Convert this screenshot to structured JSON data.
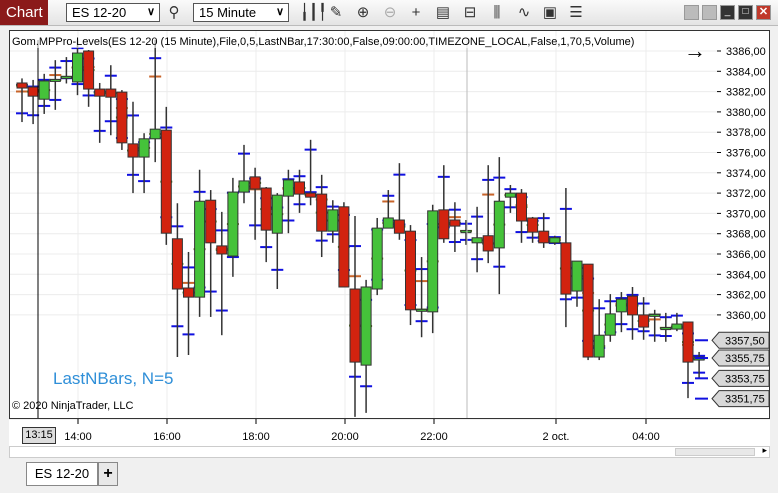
{
  "window": {
    "title": "Chart",
    "instrument": "ES 12-20",
    "interval": "15 Minute"
  },
  "toolbar": {
    "icons": [
      "search-icon",
      "bar-type-icon",
      "draw-icon",
      "zoom-in-icon",
      "zoom-out-icon",
      "crosshair-icon",
      "data-box-icon",
      "properties-icon",
      "indicators-icon",
      "strategies-icon",
      "templates-icon",
      "list-icon"
    ]
  },
  "chart": {
    "indicator_label": "Gom.MPPro-Levels(ES 12-20 (15 Minute),File,0,5,LastNBar,17:30:00,False,09:00:00,TIMEZONE_LOCAL,False,1,70,5,Volume)",
    "overlay_text": "LastNBars, N=5",
    "copyright": "© 2020 NinjaTrader, LLC",
    "cursor_time": "13:15",
    "price_tags": [
      "3357,50",
      "3355,75",
      "3353,75",
      "3351,75"
    ],
    "colors": {
      "up": "#45c23a",
      "down": "#d2230f",
      "level_blue": "#1010e0",
      "level_orange": "#c8642a",
      "level_olive": "#5a7a1a",
      "overlay": "#2f8fd8"
    }
  },
  "bottom": {
    "tab": "ES 12-20",
    "add": "+"
  },
  "chart_data": {
    "type": "candlestick",
    "title": "ES 12-20 (15 Minute)",
    "ylim": [
      3348.5,
      3388
    ],
    "y_ticks": [
      "3386,00",
      "3384,00",
      "3382,00",
      "3380,00",
      "3378,00",
      "3376,00",
      "3374,00",
      "3372,00",
      "3370,00",
      "3368,00",
      "3366,00",
      "3364,00",
      "3362,00",
      "3360,00"
    ],
    "x_ticks": [
      "14:00",
      "16:00",
      "18:00",
      "20:00",
      "22:00",
      "2 oct.",
      "04:00"
    ],
    "start_time": "12:45",
    "bar_minutes": 15,
    "ohlc": [
      [
        3382.85,
        3383.3,
        3379.0,
        3382.35
      ],
      [
        3382.45,
        3383.15,
        3378.8,
        3381.55
      ],
      [
        3381.25,
        3383.75,
        3379.8,
        3383.05
      ],
      [
        3383.1,
        3385.1,
        3380.2,
        3383.2
      ],
      [
        3383.4,
        3385.4,
        3382.8,
        3383.5
      ],
      [
        3382.95,
        3387.1,
        3381.65,
        3385.8
      ],
      [
        3386.0,
        3386.1,
        3380.5,
        3382.25
      ],
      [
        3382.25,
        3382.85,
        3376.95,
        3381.55
      ],
      [
        3382.25,
        3384.6,
        3377.7,
        3381.45
      ],
      [
        3381.95,
        3382.15,
        3376.25,
        3376.95
      ],
      [
        3376.85,
        3381.0,
        3372.0,
        3375.55
      ],
      [
        3375.55,
        3377.9,
        3372.0,
        3377.35
      ],
      [
        3377.35,
        3387.1,
        3375.05,
        3378.3
      ],
      [
        3378.2,
        3380.5,
        3366.9,
        3368.05
      ],
      [
        3367.5,
        3371.0,
        3355.85,
        3362.55
      ],
      [
        3362.65,
        3366.2,
        3356.05,
        3361.75
      ],
      [
        3361.75,
        3374.3,
        3359.8,
        3371.2
      ],
      [
        3371.3,
        3372.3,
        3359.8,
        3367.1
      ],
      [
        3366.8,
        3370.15,
        3358.0,
        3366.0
      ],
      [
        3365.8,
        3373.5,
        3363.75,
        3372.1
      ],
      [
        3372.1,
        3376.75,
        3371.0,
        3373.2
      ],
      [
        3373.6,
        3374.5,
        3367.4,
        3372.4
      ],
      [
        3372.5,
        3372.6,
        3365.2,
        3368.35
      ],
      [
        3368.05,
        3372.0,
        3362.55,
        3371.8
      ],
      [
        3371.7,
        3374.3,
        3368.05,
        3373.3
      ],
      [
        3373.1,
        3374.3,
        3370.05,
        3371.9
      ],
      [
        3372.0,
        3377.25,
        3370.8,
        3371.6
      ],
      [
        3371.9,
        3373.8,
        3365.7,
        3368.25
      ],
      [
        3368.25,
        3371.3,
        3367.1,
        3370.35
      ],
      [
        3370.65,
        3371.1,
        3362.75,
        3362.75
      ],
      [
        3362.55,
        3369.75,
        3349.95,
        3355.35
      ],
      [
        3355.05,
        3363.45,
        3350.35,
        3362.75
      ],
      [
        3362.55,
        3369.55,
        3361.95,
        3368.55
      ],
      [
        3368.55,
        3372.3,
        3368.55,
        3369.55
      ],
      [
        3369.35,
        3374.95,
        3367.4,
        3368.05
      ],
      [
        3368.25,
        3368.85,
        3359.0,
        3360.5
      ],
      [
        3360.5,
        3365.7,
        3357.8,
        3360.55
      ],
      [
        3360.3,
        3370.85,
        3358.2,
        3370.25
      ],
      [
        3370.35,
        3374.75,
        3367.1,
        3367.5
      ],
      [
        3369.35,
        3371.1,
        3366.2,
        3368.75
      ],
      [
        3368.25,
        3369.35,
        3366.9,
        3368.3
      ],
      [
        3367.1,
        3370.65,
        3364.2,
        3367.6
      ],
      [
        3367.8,
        3374.75,
        3365.1,
        3366.3
      ],
      [
        3366.6,
        3375.55,
        3362.05,
        3371.2
      ],
      [
        3371.6,
        3372.8,
        3370.05,
        3372.0
      ],
      [
        3372.0,
        3372.4,
        3367.1,
        3369.25
      ],
      [
        3369.55,
        3369.65,
        3367.1,
        3368.15
      ],
      [
        3368.25,
        3370.05,
        3366.6,
        3367.1
      ],
      [
        3367.1,
        3367.8,
        3366.9,
        3367.6
      ],
      [
        3367.1,
        3372.5,
        3358.8,
        3362.05
      ],
      [
        3362.35,
        3365.3,
        3360.8,
        3365.3
      ],
      [
        3365.0,
        3365.0,
        3355.55,
        3355.85
      ],
      [
        3355.85,
        3361.55,
        3355.55,
        3358.0
      ],
      [
        3358.0,
        3362.05,
        3357.35,
        3360.1
      ],
      [
        3360.3,
        3362.25,
        3358.3,
        3361.55
      ],
      [
        3361.85,
        3362.75,
        3357.55,
        3360.0
      ],
      [
        3360.0,
        3361.75,
        3357.55,
        3358.8
      ],
      [
        3360.0,
        3360.5,
        3357.35,
        3360.05
      ],
      [
        3358.7,
        3360.2,
        3357.35,
        3358.75
      ],
      [
        3358.6,
        3360.2,
        3358.4,
        3359.1
      ],
      [
        3359.3,
        3359.3,
        3351.8,
        3355.35
      ],
      [
        3355.55,
        3356.35,
        3353.8,
        3355.85
      ]
    ]
  }
}
